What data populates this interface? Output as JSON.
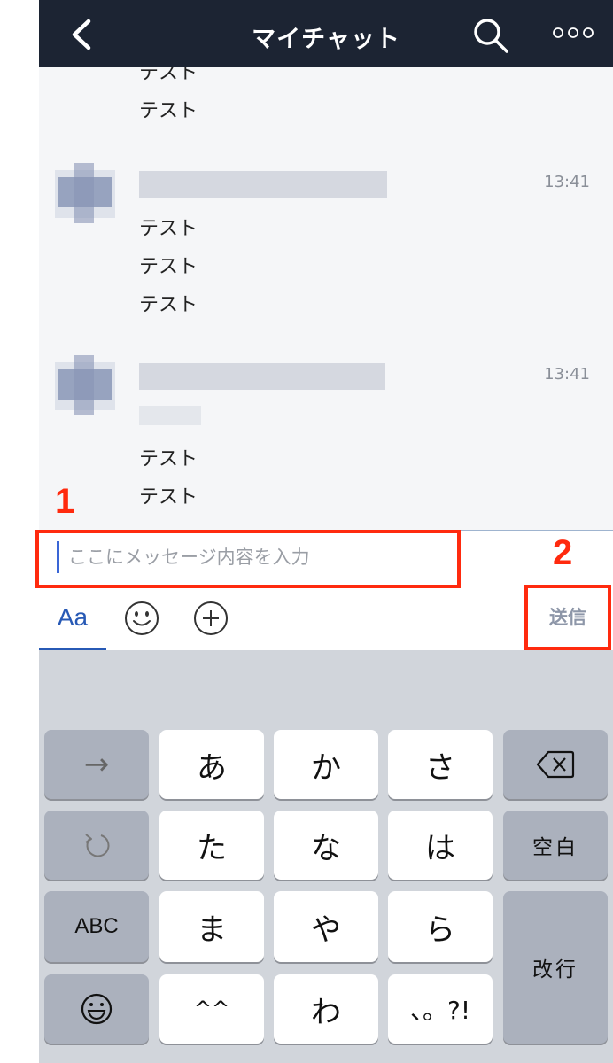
{
  "header": {
    "title": "マイチャット"
  },
  "chat": {
    "messages": [
      {
        "lines": [
          "テスト",
          "テスト"
        ]
      },
      {
        "time": "13:41",
        "lines": [
          "テスト",
          "テスト",
          "テスト"
        ]
      },
      {
        "time": "13:41",
        "lines": [
          "テスト",
          "テスト"
        ]
      }
    ]
  },
  "annotations": {
    "marker1": "1",
    "marker2": "2",
    "color": "#ff2a0e"
  },
  "input": {
    "placeholder": "ここにメッセージ内容を入力"
  },
  "toolbar": {
    "text_tab": "Aa",
    "emoji": "smiley-icon",
    "add": "plus-circle-icon",
    "send_label": "送信"
  },
  "keyboard": {
    "row1": {
      "arrow": "→",
      "k1": "あ",
      "k2": "か",
      "k3": "さ"
    },
    "row2": {
      "k1": "た",
      "k2": "な",
      "k3": "は",
      "space": "空白"
    },
    "row3": {
      "abc": "ABC",
      "k1": "ま",
      "k2": "や",
      "k3": "ら",
      "enter": "改行"
    },
    "row4": {
      "k1": "^^",
      "k2": "わ",
      "k3": "、。?!"
    }
  },
  "colors": {
    "header_bg": "#1c2433",
    "accent": "#2759b5",
    "chat_bg": "#f5f6f8"
  }
}
